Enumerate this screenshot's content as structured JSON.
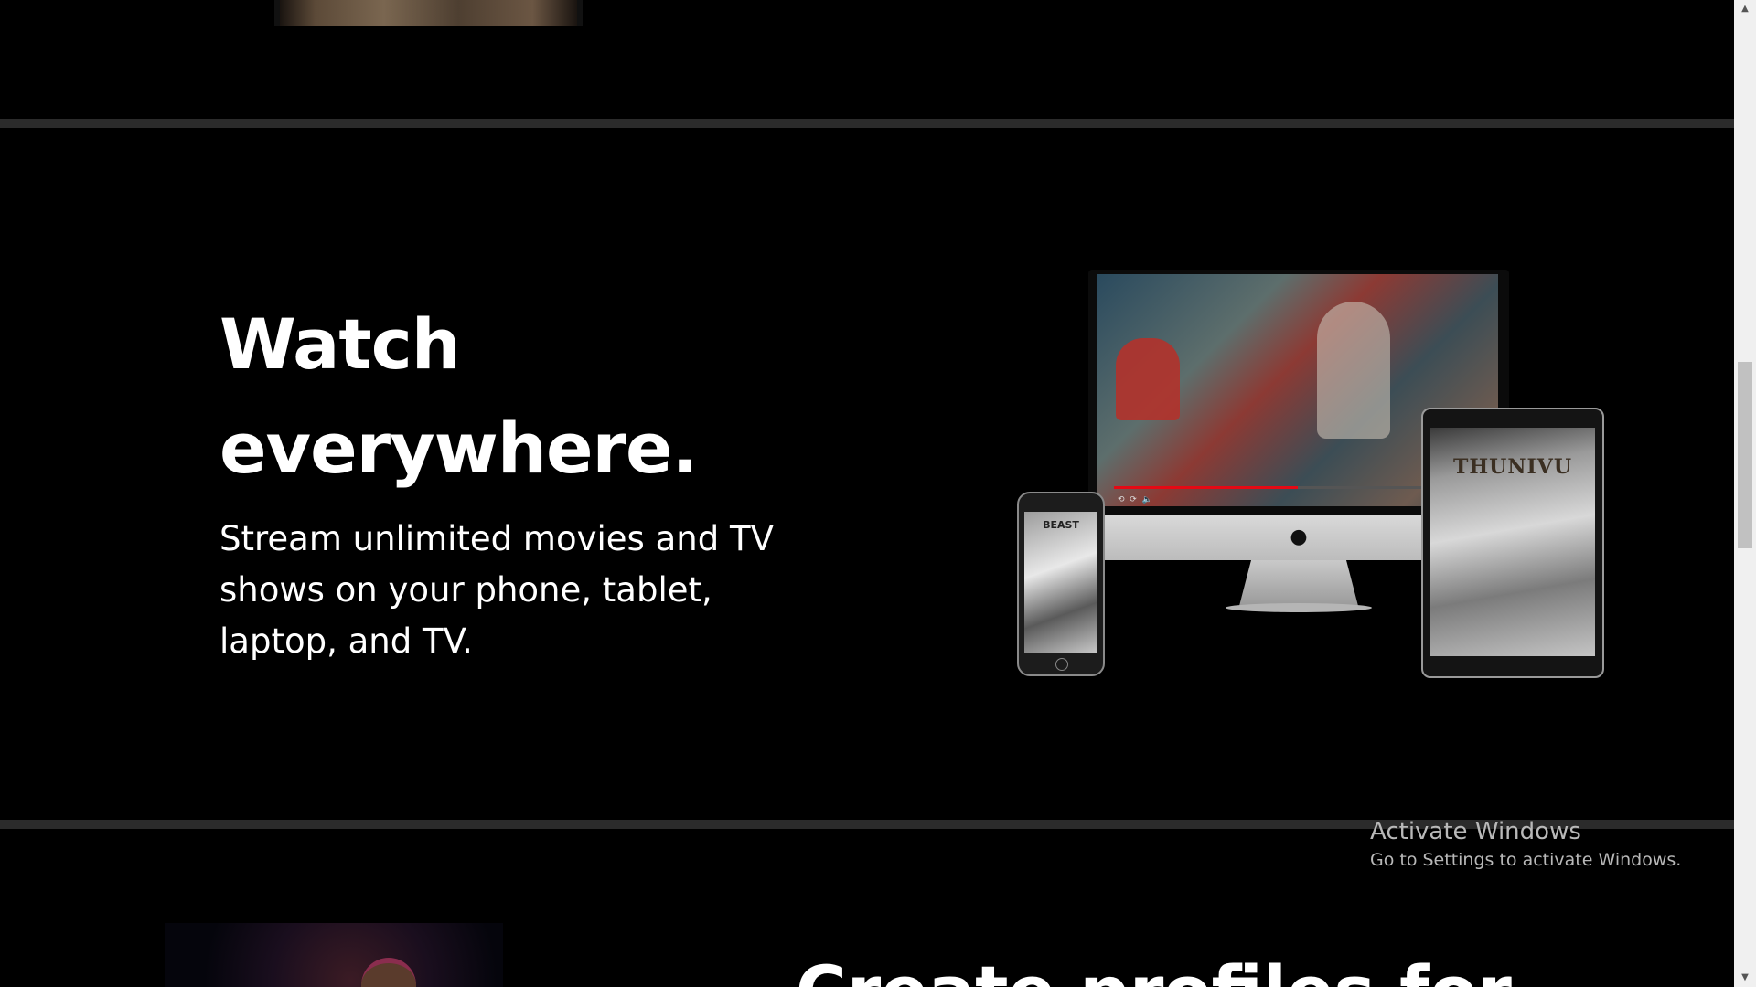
{
  "sections": {
    "watch": {
      "title_line1": "Watch",
      "title_line2": "everywhere.",
      "subtitle": "Stream unlimited movies and TV shows on your phone, tablet, laptop, and TV.",
      "image": {
        "phone_poster_text": "BEAST",
        "tablet_poster_text": "THUNIVU",
        "player_progress": 0.5
      }
    },
    "profiles": {
      "title": "Create profiles for"
    }
  },
  "watermark": {
    "title": "Activate Windows",
    "subtitle": "Go to Settings to activate Windows."
  },
  "colors": {
    "background": "#000000",
    "divider": "#2b2b2b",
    "accent": "#e50914",
    "text": "#ffffff"
  },
  "scrollbar": {
    "position": 0.45
  }
}
